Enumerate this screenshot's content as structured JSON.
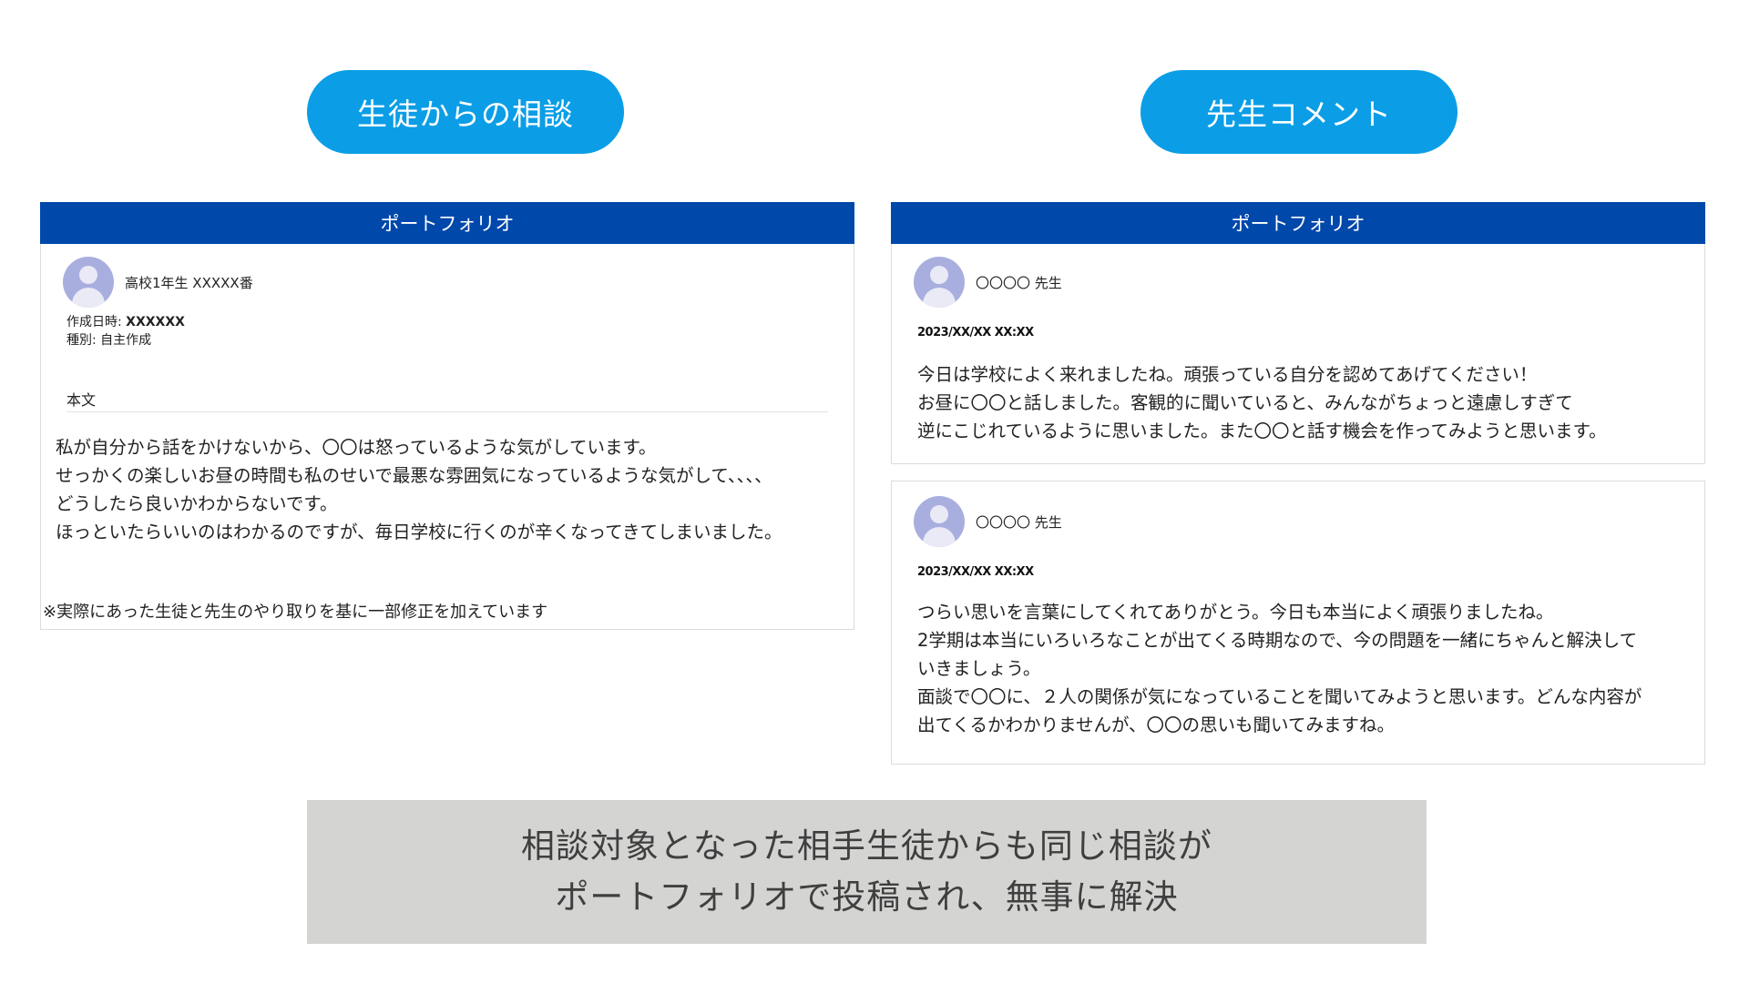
{
  "labels": {
    "student": "生徒からの相談",
    "teacher": "先生コメント"
  },
  "student_panel": {
    "header": "ポートフォリオ",
    "author": "高校1年生 XXXXX番",
    "created_label": "作成日時:",
    "created_value": "XXXXXX",
    "type_label": "種別:",
    "type_value": "自主作成",
    "section": "本文",
    "lines": [
      "私が自分から話をかけないから、〇〇は怒っているような気がしています。",
      "せっかくの楽しいお昼の時間も私のせいで最悪な雰囲気になっているような気がして、、、、",
      "どうしたら良いかわからないです。",
      "ほっといたらいいのはわかるのですが、毎日学校に行くのが辛くなってきてしまいました。"
    ]
  },
  "teacher_panel": {
    "header": "ポートフォリオ",
    "comments": [
      {
        "author": "〇〇〇〇 先生",
        "date": "2023/XX/XX XX:XX",
        "lines": [
          "今日は学校によく来れましたね。頑張っている自分を認めてあげてください！",
          "お昼に〇〇と話しました。客観的に聞いていると、みんながちょっと遠慮しすぎて",
          "逆にこじれているように思いました。また〇〇と話す機会を作ってみようと思います。"
        ]
      },
      {
        "author": "〇〇〇〇 先生",
        "date": "2023/XX/XX XX:XX",
        "lines": [
          "つらい思いを言葉にしてくれてありがとう。今日も本当によく頑張りましたね。",
          "2学期は本当にいろいろなことが出てくる時期なので、今の問題を一緒にちゃんと解決して",
          "いきましょう。",
          "面談で〇〇に、２人の関係が気になっていることを聞いてみようと思います。どんな内容が",
          "出てくるかわかりませんが、〇〇の思いも聞いてみますね。"
        ]
      }
    ]
  },
  "note": "※実際にあった生徒と先生のやり取りを基に一部修正を加えています",
  "summary": {
    "line1": "相談対象となった相手生徒からも同じ相談が",
    "line2": "ポートフォリオで投稿され、無事に解決"
  }
}
